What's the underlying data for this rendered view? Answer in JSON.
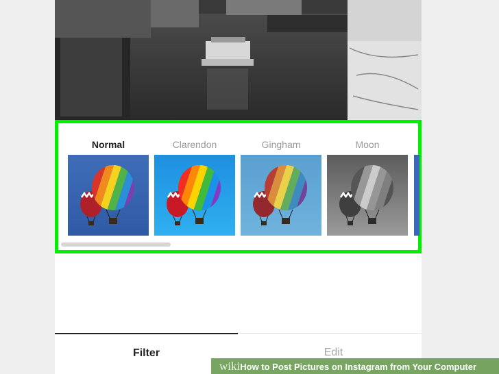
{
  "filters": [
    {
      "name": "Normal",
      "selected": true,
      "bg_top": "#3f6db8",
      "bg_bottom": "#2f5aa6",
      "saturation": 1
    },
    {
      "name": "Clarendon",
      "selected": false,
      "bg_top": "#1e8fe0",
      "bg_bottom": "#2fb0f0",
      "saturation": 1.2
    },
    {
      "name": "Gingham",
      "selected": false,
      "bg_top": "#5a9fd0",
      "bg_bottom": "#6fb3de",
      "saturation": 0.75
    },
    {
      "name": "Moon",
      "selected": false,
      "bg_top": "#5c5c5c",
      "bg_bottom": "#9a9a9a",
      "saturation": 0
    }
  ],
  "tabs": {
    "filter_label": "Filter",
    "edit_label": "Edit"
  },
  "watermark": {
    "wiki_text": "wiki",
    "how_text": "How",
    "rest_text": " to Post Pictures on Instagram from Your Computer"
  },
  "colors": {
    "highlight": "#00f000"
  }
}
